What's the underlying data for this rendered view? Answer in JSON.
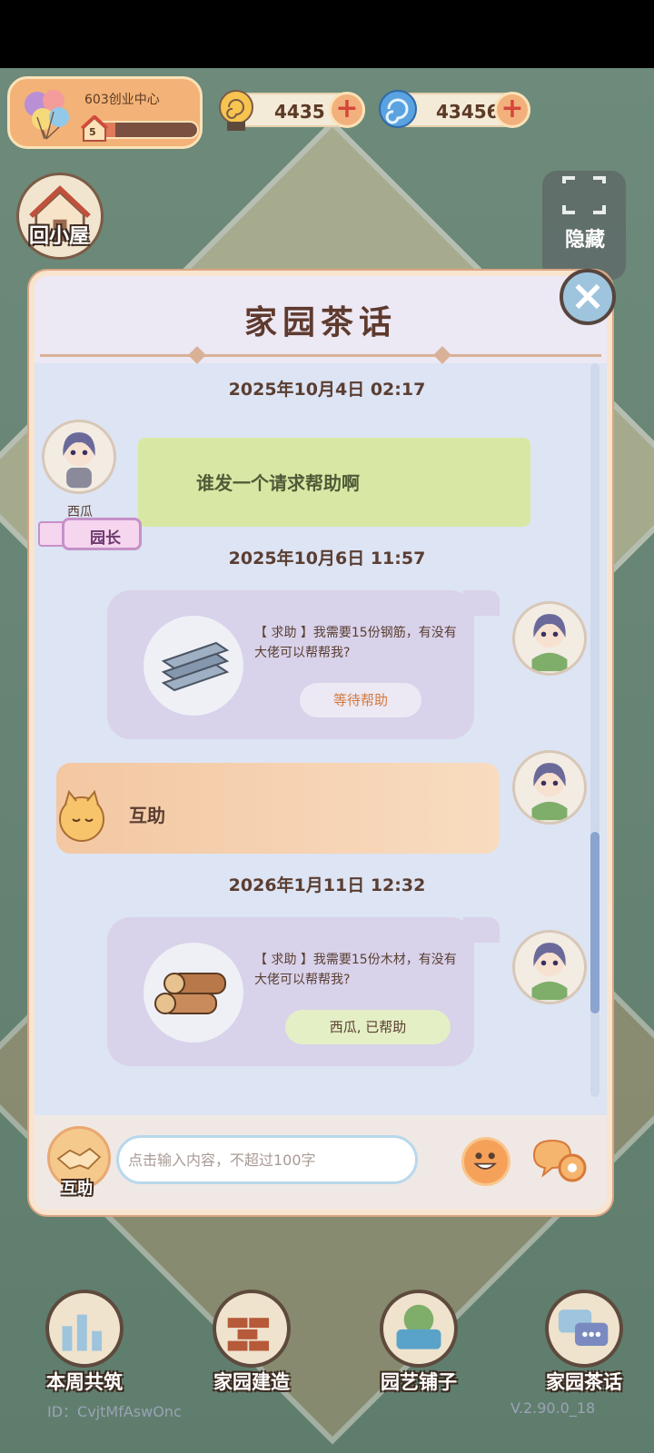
{
  "profile": {
    "garden_name": "603创业中心",
    "level": "5",
    "level_progress": 0.25
  },
  "currencies": [
    {
      "icon": "snail-coin-icon",
      "value": "4435"
    },
    {
      "icon": "swirl-gem-icon",
      "value": "43456"
    }
  ],
  "side": {
    "home_label": "回小屋",
    "hide_label": "隐藏"
  },
  "dialog": {
    "title": "家园茶话",
    "messages": [
      {
        "timestamp": "2025年10月4日 02:17",
        "sender": "西瓜",
        "role": "园长",
        "text": "谁发一个请求帮助啊"
      },
      {
        "timestamp": "2025年10月6日 11:57",
        "text": "【 求助 】我需要15份钢筋，有没有大佬可以帮帮我?",
        "status": "等待帮助",
        "item": "steel-beam-icon"
      },
      {
        "text": "互助"
      },
      {
        "timestamp": "2026年1月11日 12:32",
        "text": "【 求助 】我需要15份木材，有没有大佬可以帮帮我?",
        "status": "西瓜, 已帮助",
        "item": "wood-log-icon"
      }
    ]
  },
  "input": {
    "placeholder": "点击输入内容，不超过100字",
    "help_label": "互助"
  },
  "nav": [
    {
      "label": "本周共筑",
      "icon": "weekly-build-icon"
    },
    {
      "label": "家园建造",
      "icon": "brick-build-icon"
    },
    {
      "label": "园艺铺子",
      "icon": "garden-shop-icon"
    },
    {
      "label": "家园茶话",
      "icon": "chat-icon"
    }
  ],
  "footer": {
    "id": "ID：CvjtMfAswOnc",
    "version": "V.2.90.0_18"
  },
  "colors": {
    "accent": "#f3b277",
    "dialog_bg": "#dde4f3",
    "title": "#5e3a2e"
  }
}
